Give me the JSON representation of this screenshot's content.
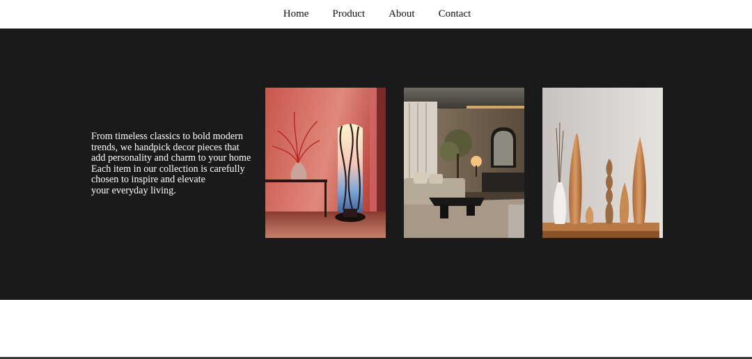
{
  "nav": {
    "items": [
      {
        "label": "Home"
      },
      {
        "label": "Product"
      },
      {
        "label": "About"
      },
      {
        "label": "Contact"
      }
    ]
  },
  "hero": {
    "tagline_lines": [
      "From timeless classics to bold modern",
      "trends, we handpick decor pieces that",
      "add personality and charm to your home",
      "Each item in our collection is carefully",
      "chosen to inspire and elevate",
      "your everyday living."
    ],
    "background": "#1a1a1a"
  },
  "gallery": [
    {
      "subject": "floor-lamp-with-red-vase"
    },
    {
      "subject": "modern-living-room"
    },
    {
      "subject": "wooden-sculptures-with-vase"
    }
  ]
}
